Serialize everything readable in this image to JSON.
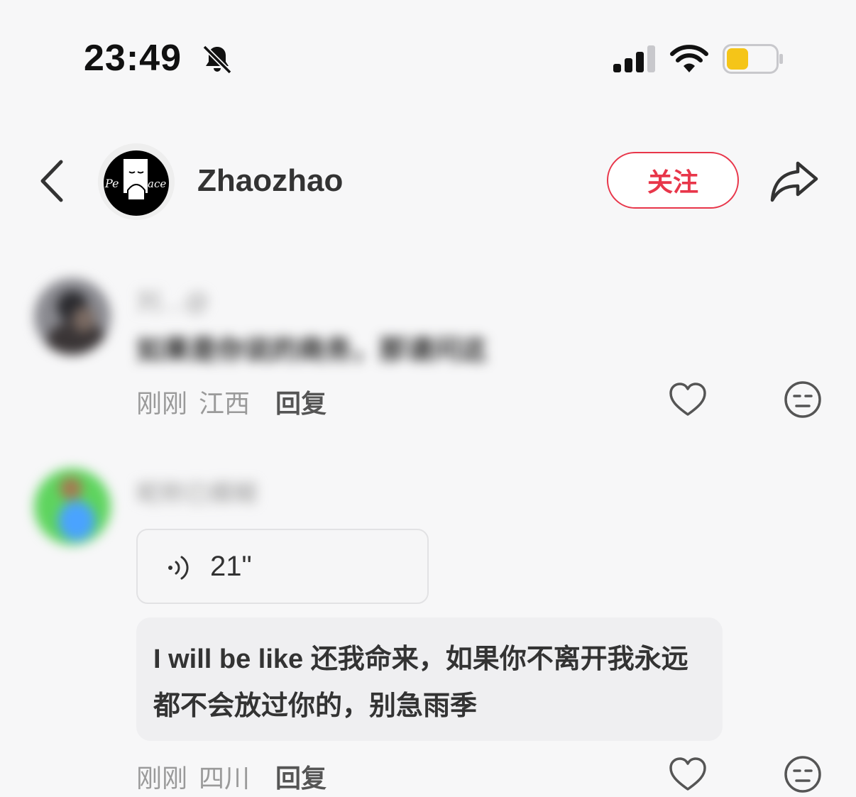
{
  "status_bar": {
    "time": "23:49",
    "mute_icon": "bell-slash-icon",
    "signal_icon": "cellular-signal-icon",
    "wifi_icon": "wifi-icon",
    "battery_icon": "battery-low-power-icon",
    "battery_level": 0.45,
    "battery_color": "#f5c518"
  },
  "header": {
    "back_icon": "chevron-left-icon",
    "profile_name": "Zhaozhao",
    "avatar_text_left": "Pe",
    "avatar_text_right": "ace",
    "follow_label": "关注",
    "follow_color": "#e8364a",
    "share_icon": "share-arrow-icon"
  },
  "comments": [
    {
      "author": "刘…@",
      "text": "如果是你说的商务，那请问这",
      "time": "刚刚",
      "location": "江西",
      "reply_label": "回复",
      "like_icon": "heart-icon",
      "dislike_icon": "meh-face-icon"
    },
    {
      "author": "昵称已模糊",
      "voice_icon": "voice-wave-icon",
      "voice_duration": "21\"",
      "transcript": "I will be like 还我命来，如果你不离开我永远都不会放过你的，别急雨季",
      "time": "刚刚",
      "location": "四川",
      "reply_label": "回复",
      "like_icon": "heart-icon",
      "dislike_icon": "meh-face-icon"
    }
  ]
}
